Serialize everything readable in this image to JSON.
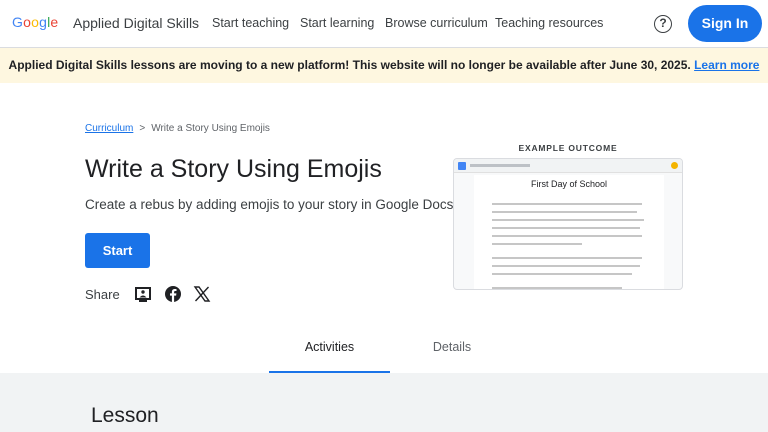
{
  "header": {
    "logo": "Google",
    "logo_colors": [
      "#4285f4",
      "#ea4335",
      "#fbbc05",
      "#4285f4",
      "#34a853",
      "#ea4335"
    ],
    "product": "Applied Digital Skills",
    "nav": [
      "Start teaching",
      "Start learning",
      "Browse curriculum",
      "Teaching resources"
    ],
    "help_icon": "?",
    "signin": "Sign In"
  },
  "banner": {
    "message": "Applied Digital Skills lessons are moving to a new platform! This website will no longer be available after June 30, 2025.",
    "link": "Learn more"
  },
  "breadcrumb": {
    "link": "Curriculum",
    "separator": ">",
    "current": "Write a Story Using Emojis"
  },
  "main": {
    "title": "Write a Story Using Emojis",
    "subtitle": "Create a rebus by adding emojis to your story in Google Docs.",
    "start_button": "Start",
    "share_label": "Share",
    "share_icons": [
      "google-classroom-icon",
      "facebook-icon",
      "x-icon"
    ]
  },
  "example": {
    "label": "EXAMPLE OUTCOME",
    "doc_title": "First Day of School"
  },
  "tabs": [
    "Activities",
    "Details"
  ],
  "lesson_heading": "Lesson",
  "colors": {
    "accent": "#1a73e8",
    "banner_bg": "#fef7e0"
  }
}
